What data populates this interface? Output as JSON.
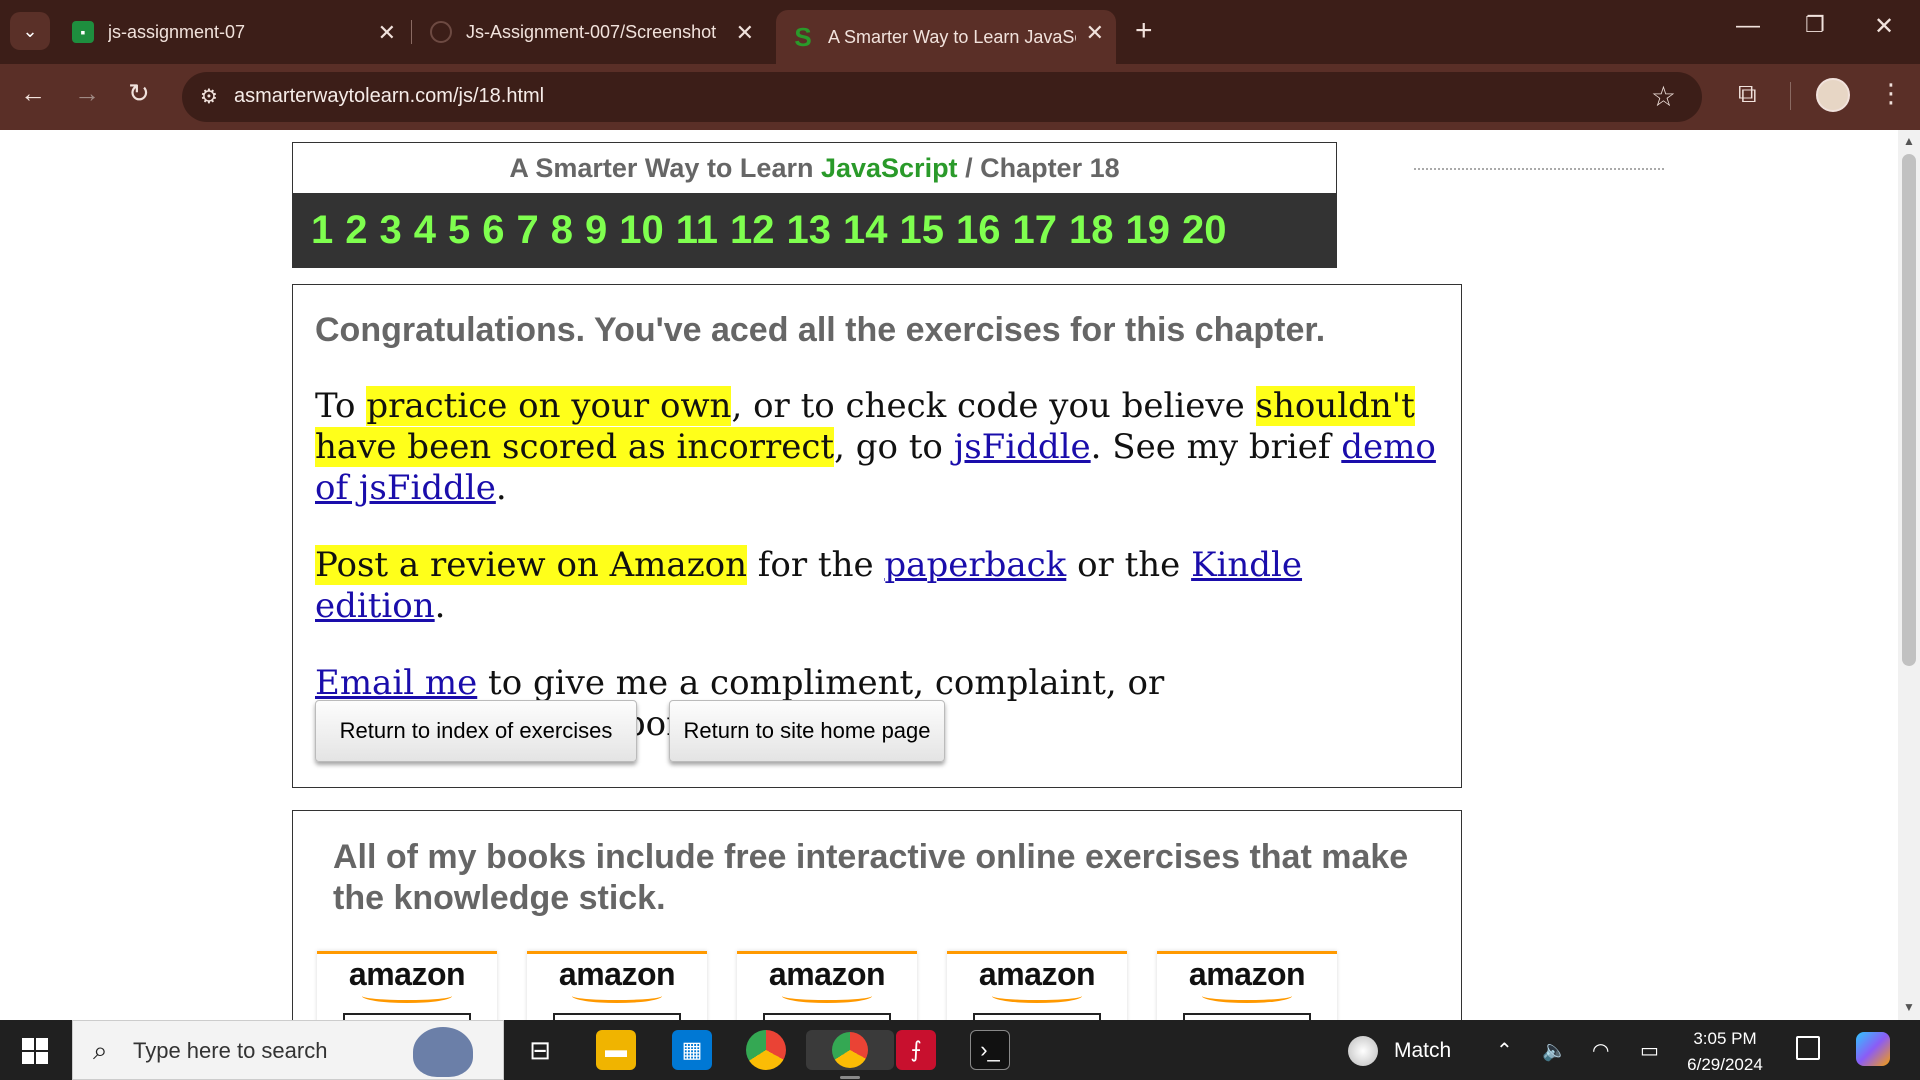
{
  "browser": {
    "tabs": [
      {
        "label": "js-assignment-07",
        "icon": "google-classroom-icon",
        "color": "#1e8e3e"
      },
      {
        "label": "Js-Assignment-007/Screenshot",
        "icon": "github-icon",
        "color": "#222222"
      },
      {
        "label": "A Smarter Way to Learn JavaScr",
        "icon": "smarter-way-s-icon",
        "color": "#2a9a2a"
      }
    ],
    "url": "asmarterwaytolearn.com/js/18.html",
    "accent": "#5a2f27"
  },
  "header": {
    "title_prefix": "A Smarter Way to Learn ",
    "title_brand": "JavaScript",
    "title_suffix": " / Chapter 18",
    "chapters": [
      "1",
      "2",
      "3",
      "4",
      "5",
      "6",
      "7",
      "8",
      "9",
      "10",
      "11",
      "12",
      "13",
      "14",
      "15",
      "16",
      "17",
      "18",
      "19",
      "20"
    ]
  },
  "main": {
    "congrats": "Congratulations. You've aced all the exercises for this chapter.",
    "p1": {
      "t1": "To ",
      "h1": "practice on your own",
      "t2": ", or to check code you believe ",
      "h2": "shouldn't have been scored as incorrect",
      "t3": ", go to ",
      "l1": "jsFiddle",
      "t4": ". See my brief ",
      "l2": "demo of jsFiddle",
      "t5": "."
    },
    "p2": {
      "h1": "Post a review on Amazon",
      "t1": " for the ",
      "l1": "paperback",
      "t2": " or the ",
      "l2": "Kindle edition",
      "t3": "."
    },
    "p3": {
      "l1": "Email me",
      "t1": " to give me a compliment, complaint, or correction. I'll respond."
    },
    "buttons": {
      "index": "Return to index of exercises",
      "home": "Return to site home page"
    }
  },
  "books": {
    "title": "All of my books include free interactive online exercises that make the knowledge stick.",
    "logo_text": "amazon",
    "count": 5
  },
  "taskbar": {
    "search_placeholder": "Type here to search",
    "weather": "Match",
    "time": "3:05 PM",
    "date": "6/29/2024"
  }
}
